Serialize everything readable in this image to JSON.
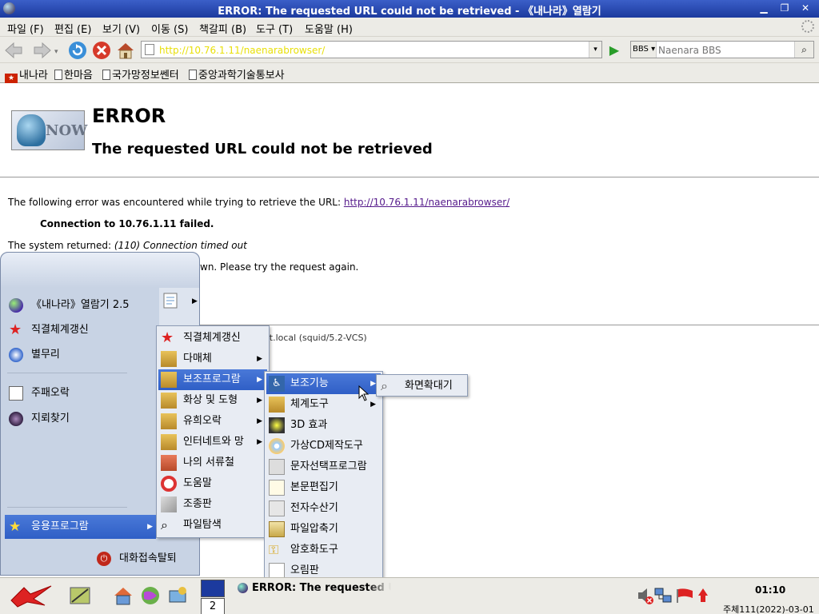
{
  "window": {
    "title": "ERROR: The requested URL could not be retrieved - 《내나라》열람기",
    "controls": [
      "minimize",
      "maximize",
      "close"
    ]
  },
  "menubar": {
    "items": [
      "파일 (F)",
      "편집 (E)",
      "보기 (V)",
      "이동 (S)",
      "책갈피 (B)",
      "도구 (T)",
      "도움말 (H)"
    ]
  },
  "navbar": {
    "url": "http://10.76.1.11/naenarabrowser/",
    "search_engine": "BBS",
    "search_placeholder": "Naenara BBS"
  },
  "bookmarks": [
    "내나라",
    "한마음",
    "국가망정보쎈터",
    "중앙과학기술통보사"
  ],
  "page": {
    "logo_text": "NOW",
    "heading": "ERROR",
    "subheading": "The requested URL could not be retrieved",
    "line1_prefix": "The following error was encountered while trying to retrieve the URL: ",
    "line1_link": "http://10.76.1.11/naenarabrowser/",
    "line2": "Connection to 10.76.1.11 failed.",
    "line3_prefix": "The system returned: ",
    "line3_italic": "(110) Connection timed out",
    "line4_visible": "wn. Please try the request again.",
    "footer_visible": "et.local (squid/5.2-VCS)"
  },
  "start_menu": {
    "items": [
      {
        "label": "《내나라》열람기 2.5",
        "icon": "globe-icon"
      },
      {
        "label": "직결체계갱신",
        "icon": "star-icon"
      },
      {
        "label": "별무리",
        "icon": "network-icon"
      },
      {
        "label": "주패오락",
        "icon": "cards-icon"
      },
      {
        "label": "지뢰찾기",
        "icon": "mine-icon"
      }
    ],
    "apps_label": "응용프로그람",
    "logout_label": "대화접속탈퇴"
  },
  "apps_menu": {
    "items": [
      {
        "label": "직결체계갱신",
        "arrow": false
      },
      {
        "label": "다매체",
        "arrow": true
      },
      {
        "label": "보조프로그람",
        "arrow": true,
        "highlighted": true
      },
      {
        "label": "화상 및 도형",
        "arrow": true
      },
      {
        "label": "유희오락",
        "arrow": true
      },
      {
        "label": "인터네트와 망",
        "arrow": true
      },
      {
        "label": "나의 서류철",
        "arrow": false
      },
      {
        "label": "도움말",
        "arrow": false
      },
      {
        "label": "조종판",
        "arrow": false
      },
      {
        "label": "파일탐색",
        "arrow": false
      }
    ]
  },
  "accessories_menu": {
    "items": [
      {
        "label": "보조기능",
        "arrow": true,
        "highlighted": true
      },
      {
        "label": "체계도구",
        "arrow": true
      },
      {
        "label": "3D 효과",
        "arrow": false
      },
      {
        "label": "가상CD제작도구",
        "arrow": false
      },
      {
        "label": "문자선택프로그람",
        "arrow": false
      },
      {
        "label": "본문편집기",
        "arrow": false
      },
      {
        "label": "전자수산기",
        "arrow": false
      },
      {
        "label": "파일압축기",
        "arrow": false
      },
      {
        "label": "암호화도구",
        "arrow": false
      },
      {
        "label": "오림판",
        "arrow": false
      }
    ]
  },
  "accessibility_menu": {
    "items": [
      {
        "label": "화면확대기"
      }
    ]
  },
  "taskbar": {
    "pager_label": "2",
    "task_title": "ERROR: The requested URL could not be retrieved",
    "clock": "01:10",
    "date": "주체111(2022)-03-01"
  },
  "colors": {
    "titlebar": "#1c3a9e",
    "highlight": "#2f5fc6",
    "menu_bg": "#e8ecf3",
    "url_text": "#e9e00a",
    "link": "#551a8b"
  }
}
